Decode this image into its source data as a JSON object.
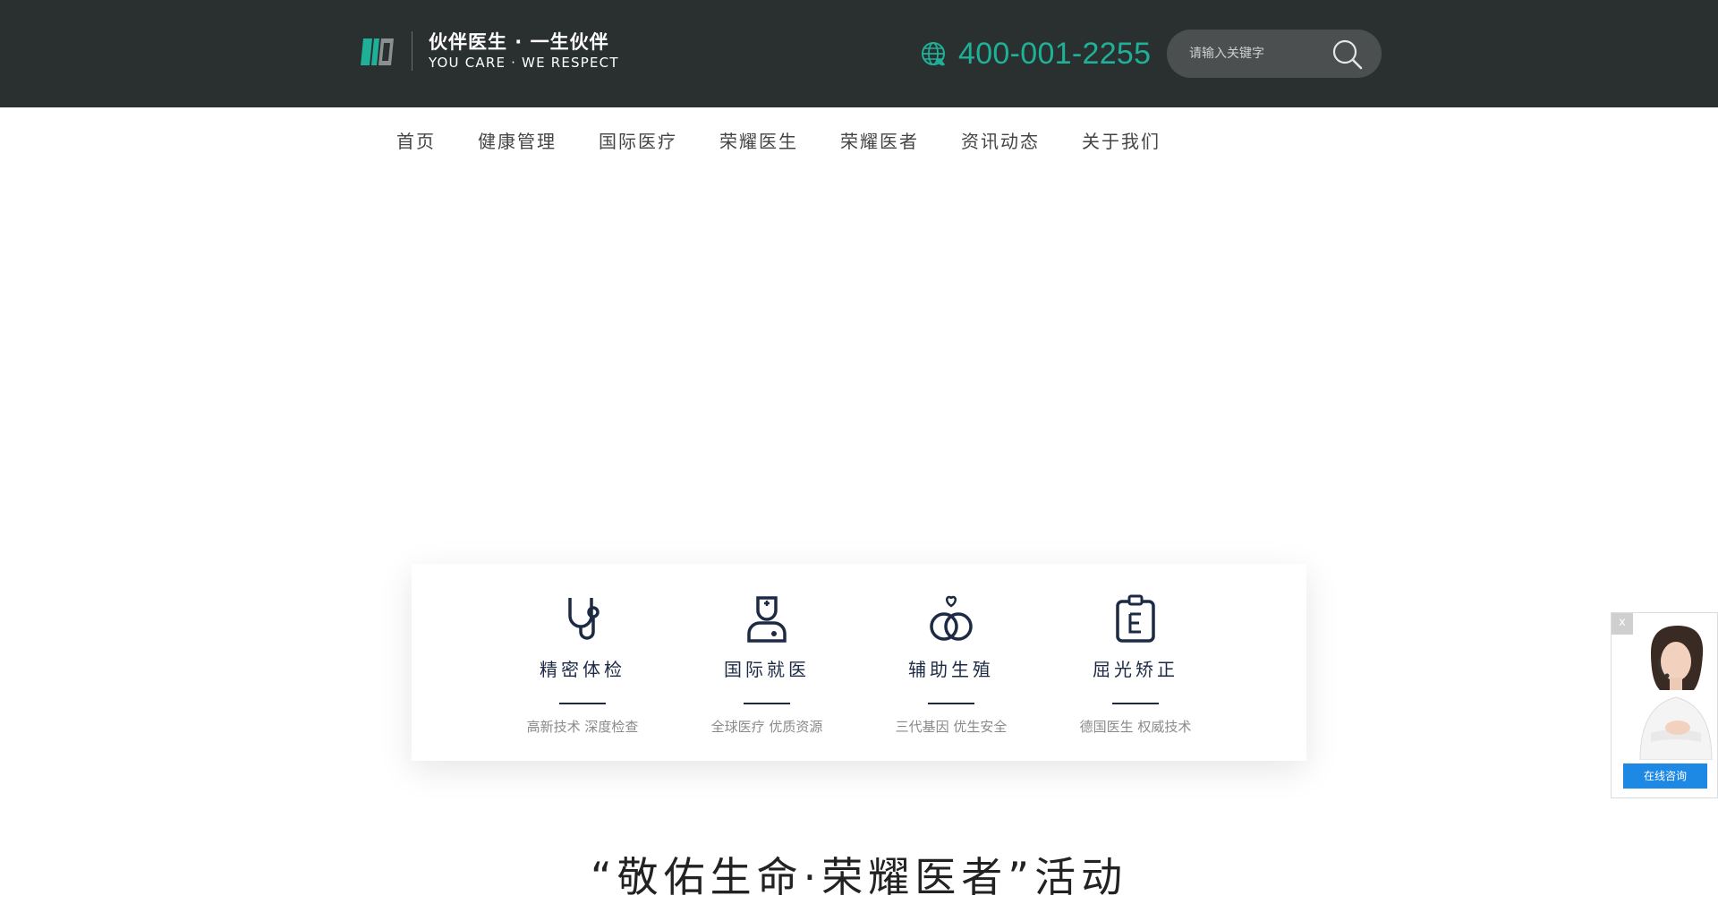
{
  "header": {
    "logo_cn": "伙伴医生 · 一生伙伴",
    "logo_en": "YOU CARE · WE RESPECT",
    "phone": "400-001-2255",
    "search_placeholder": "请输入关键字"
  },
  "nav": {
    "items": [
      "首页",
      "健康管理",
      "国际医疗",
      "荣耀医生",
      "荣耀医者",
      "资讯动态",
      "关于我们"
    ]
  },
  "services": [
    {
      "title": "精密体检",
      "desc": "高新技术 深度检查",
      "icon": "stethoscope-icon"
    },
    {
      "title": "国际就医",
      "desc": "全球医疗 优质资源",
      "icon": "doctor-icon"
    },
    {
      "title": "辅助生殖",
      "desc": "三代基因 优生安全",
      "icon": "rings-icon"
    },
    {
      "title": "屈光矫正",
      "desc": "德国医生 权威技术",
      "icon": "eye-chart-icon"
    }
  ],
  "section": {
    "title": "“敬佑生命·荣耀医者”活动"
  },
  "consult": {
    "close_label": "x",
    "button_label": "在线咨询"
  },
  "colors": {
    "header_bg": "#2a2f2f",
    "accent_teal": "#1fb198",
    "navy": "#1d2a44",
    "consult_blue": "#1e88e5"
  }
}
